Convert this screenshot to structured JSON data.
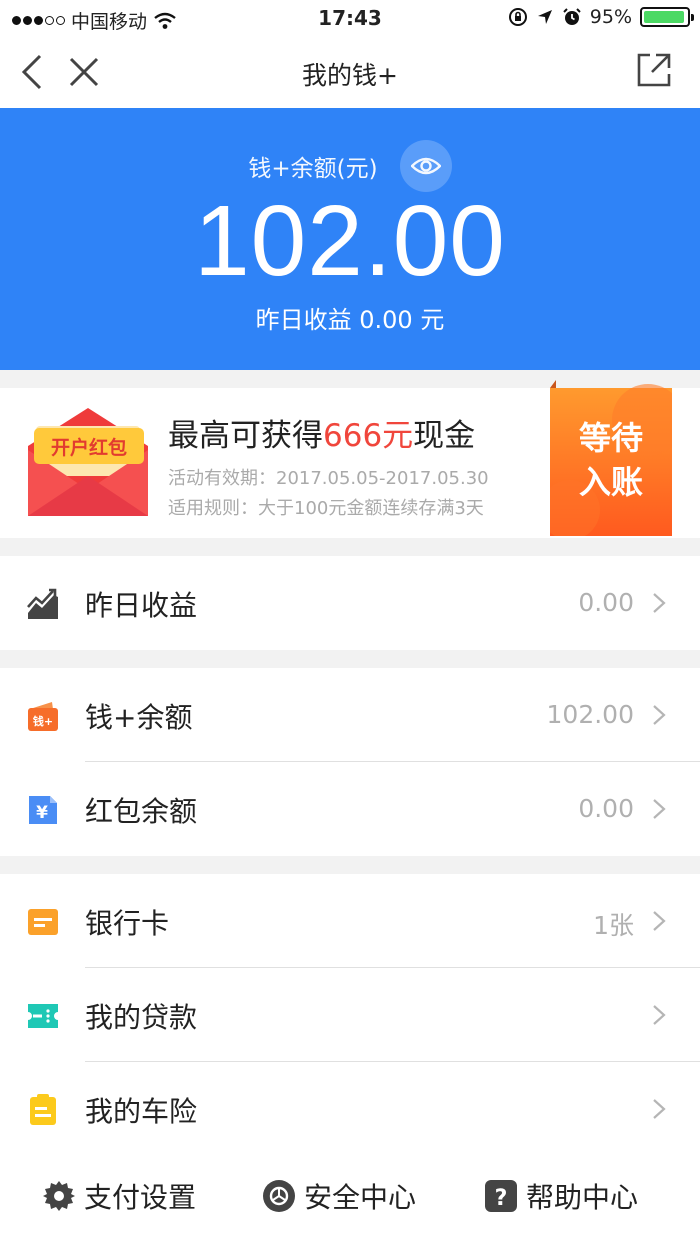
{
  "status_bar": {
    "carrier": "中国移动",
    "time": "17:43",
    "battery_text": "95%",
    "battery_level": 0.95,
    "signal_bars_filled": 3,
    "signal_bars_total": 5,
    "icons": [
      "wifi-icon",
      "rotation-lock-icon",
      "location-icon",
      "alarm-icon",
      "battery-icon"
    ]
  },
  "nav": {
    "title": "我的钱+",
    "icons": [
      "back-icon",
      "close-icon",
      "share-icon"
    ]
  },
  "hero": {
    "balance_label": "钱+余额(元)",
    "amount": "102.00",
    "yesterday": "昨日收益 0.00 元",
    "color": "#2f83f7"
  },
  "promo": {
    "envelope_text": "开户红包",
    "headline_pre": "最高可获得",
    "headline_highlight": "666元",
    "headline_post": "现金",
    "period": "活动有效期：2017.05.05-2017.05.30",
    "rule": "适用规则：大于100元金额连续存满3天",
    "tag_line1": "等待",
    "tag_line2": "入账",
    "highlight_color": "#f0463c"
  },
  "rows": [
    {
      "label": "昨日收益",
      "value": "0.00",
      "icon": "trend-chart-icon"
    },
    {
      "label": "钱+余额",
      "value": "102.00",
      "icon": "wallet-icon"
    },
    {
      "label": "红包余额",
      "value": "0.00",
      "icon": "yuan-icon"
    },
    {
      "label": "银行卡",
      "value": "1张",
      "icon": "bank-card-icon"
    },
    {
      "label": "我的贷款",
      "value": "",
      "icon": "loan-ticket-icon"
    },
    {
      "label": "我的车险",
      "value": "",
      "icon": "insurance-doc-icon"
    }
  ],
  "footer": {
    "pay_settings": "支付设置",
    "security_center": "安全中心",
    "help_center": "帮助中心"
  }
}
